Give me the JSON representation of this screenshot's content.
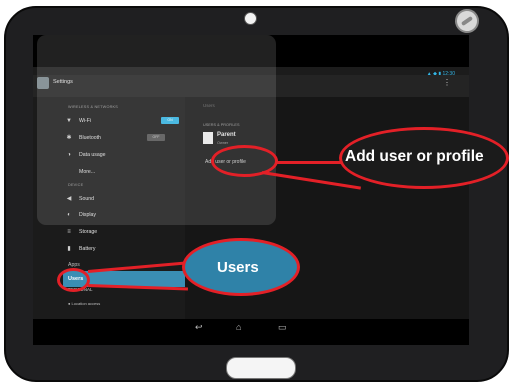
{
  "app": {
    "title": "Settings"
  },
  "statusbar": {
    "time": "12:30"
  },
  "settings": {
    "wireless_header": "WIRELESS & NETWORKS",
    "wifi": {
      "label": "Wi-Fi",
      "toggle": "ON"
    },
    "bluetooth": {
      "label": "Bluetooth",
      "toggle": "OFF"
    },
    "data_usage": "Data usage",
    "more": "More...",
    "device_header": "DEVICE",
    "sound": "Sound",
    "display": "Display",
    "storage": "Storage",
    "battery": "Battery",
    "apps_partial": "Apps",
    "users": "Users",
    "personal_header": "PERSONAL",
    "location": "Location access"
  },
  "users_pane": {
    "title": "Users",
    "section": "USERS & PROFILES",
    "parent_name": "Parent",
    "parent_sub": "Owner",
    "add_user": "Add user or profile"
  },
  "callouts": {
    "add_user": "Add user or profile",
    "users": "Users"
  },
  "colors": {
    "accent": "#33b5e5",
    "highlight": "#3a8eb4",
    "callout_red": "#e32027",
    "tablet_frame": "#1f1f21"
  },
  "icons": {
    "wifi": "wifi-icon",
    "bluetooth": "bluetooth-icon",
    "data_usage": "data-usage-icon",
    "sound": "sound-icon",
    "display": "display-icon",
    "storage": "storage-icon",
    "battery": "battery-icon",
    "back": "back-icon",
    "home": "home-icon",
    "recent": "recent-apps-icon"
  }
}
